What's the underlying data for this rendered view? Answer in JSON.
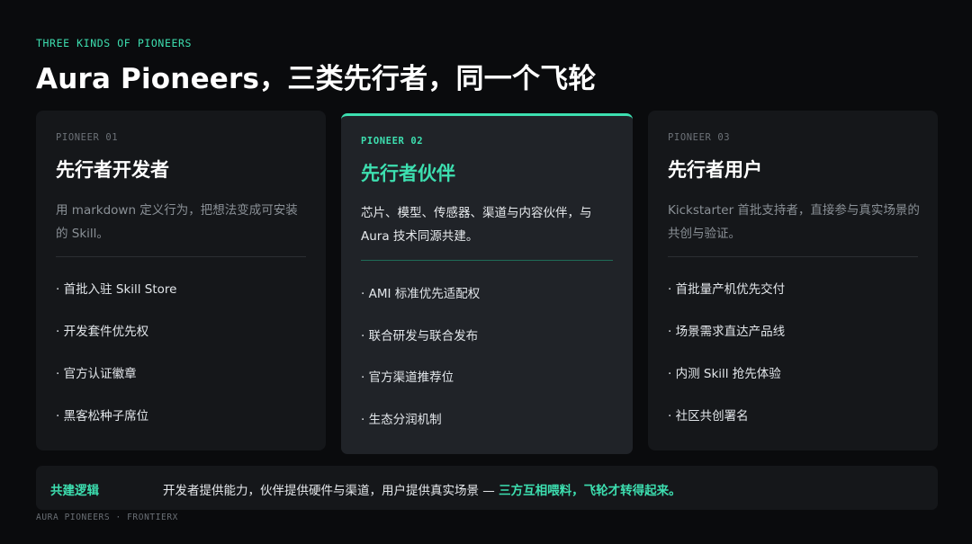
{
  "header": {
    "eyebrow": "THREE KINDS OF PIONEERS",
    "title": "Aura Pioneers，三类先行者，同一个飞轮"
  },
  "cards": [
    {
      "id": "PIONEER 01",
      "name": "先行者开发者",
      "desc": "用 markdown 定义行为，把想法变成可安装的 Skill。",
      "features": [
        "· 首批入驻 Skill Store",
        "· 开发套件优先权",
        "· 官方认证徽章",
        "· 黑客松种子席位"
      ]
    },
    {
      "id": "PIONEER 02",
      "name": "先行者伙伴",
      "desc": "芯片、模型、传感器、渠道与内容伙伴，与 Aura 技术同源共建。",
      "features": [
        "· AMI 标准优先适配权",
        "· 联合研发与联合发布",
        "· 官方渠道推荐位",
        "· 生态分润机制"
      ]
    },
    {
      "id": "PIONEER 03",
      "name": "先行者用户",
      "desc": "Kickstarter 首批支持者，直接参与真实场景的共创与验证。",
      "features": [
        "· 首批量产机优先交付",
        "· 场景需求直达产品线",
        "· 内测 Skill 抢先体验",
        "· 社区共创署名"
      ]
    }
  ],
  "summary": {
    "label": "共建逻辑",
    "text": "开发者提供能力，伙伴提供硬件与渠道，用户提供真实场景 — ",
    "highlight": "三方互相喂料，飞轮才转得起来。"
  },
  "footer": "AURA PIONEERS · FRONTIERX",
  "colors": {
    "accent": "#3ddfb0",
    "background": "#0a0b0d",
    "card": "#15171a",
    "card_highlight": "#202328"
  }
}
